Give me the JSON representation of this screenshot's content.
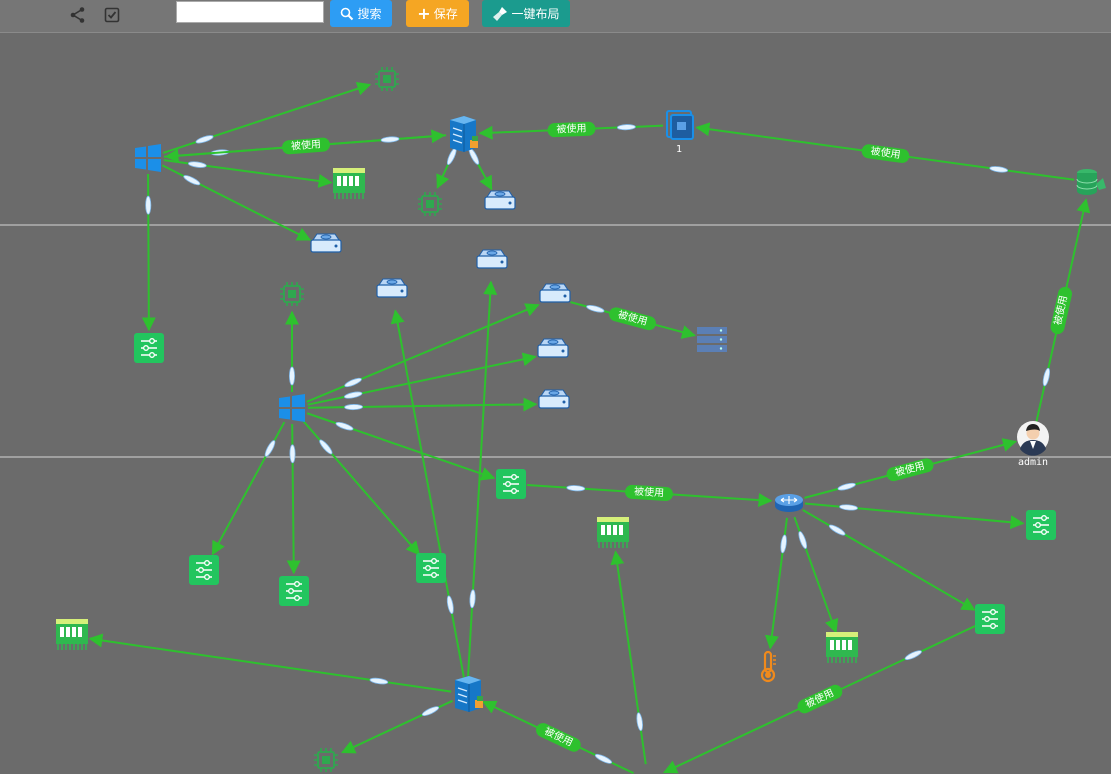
{
  "toolbar": {
    "share_icon": "share-icon",
    "checklist_icon": "checklist-icon",
    "search_placeholder": "",
    "search_label": "搜索",
    "save_label": "保存",
    "layout_label": "一键布局"
  },
  "graph": {
    "edge_label": "被使用",
    "node_labels": {
      "folder": "1",
      "user": "admin"
    }
  }
}
